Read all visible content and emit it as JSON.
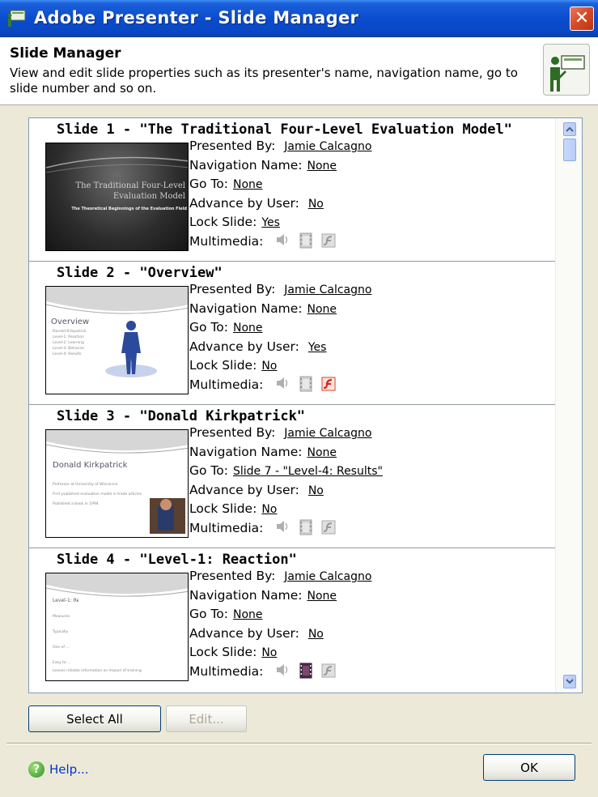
{
  "window": {
    "title": "Adobe Presenter - Slide Manager",
    "close_glyph": "✕"
  },
  "header": {
    "title": "Slide Manager",
    "description": "View and edit slide properties such as its presenter's name, navigation name, go to slide number and so on."
  },
  "labels": {
    "presented_by": "Presented By:",
    "navigation_name": "Navigation Name:",
    "go_to": "Go To:",
    "advance_by_user": "Advance by User:",
    "lock_slide": "Lock Slide:",
    "multimedia": "Multimedia:"
  },
  "slides": [
    {
      "heading": "Slide 1 - \"The Traditional Four-Level Evaluation Model\"",
      "thumb_title": "The Traditional Four-Level Evaluation Model",
      "thumb_subtitle": "The Theoretical Beginnings of the Evaluation Field",
      "presented_by": "Jamie Calcagno",
      "navigation_name": "None",
      "go_to": "None",
      "advance_by_user": "No",
      "lock_slide": "Yes",
      "multimedia": {
        "audio": false,
        "video": false,
        "flash": false
      }
    },
    {
      "heading": "Slide 2 - \"Overview\"",
      "thumb_title": "Overview",
      "thumb_bullets": [
        "Donald Kirkpatrick",
        "Level-1: Reaction",
        "Level-2: Learning",
        "Level-3: Behavior",
        "Level-4: Results"
      ],
      "presented_by": "Jamie Calcagno",
      "navigation_name": "None",
      "go_to": "None",
      "advance_by_user": "Yes",
      "lock_slide": "No",
      "multimedia": {
        "audio": false,
        "video": false,
        "flash": true
      }
    },
    {
      "heading": "Slide 3 - \"Donald Kirkpatrick\"",
      "thumb_title": "Donald Kirkpatrick",
      "thumb_bullets": [
        "Professor at University of Wisconsin",
        "First published evaluation model in trade articles",
        "Published a book in 1994"
      ],
      "presented_by": "Jamie Calcagno",
      "navigation_name": "None",
      "go_to": "Slide 7 - \"Level-4: Results\"",
      "advance_by_user": "No",
      "lock_slide": "No",
      "multimedia": {
        "audio": false,
        "video": false,
        "flash": false
      }
    },
    {
      "heading": "Slide 4 - \"Level-1: Reaction\"",
      "thumb_title": "Level-1: Reaction",
      "thumb_bullets": [
        "Measures",
        "Typically",
        "One of ...",
        "Easy to ...",
        "Leaves reliable information on impact of training"
      ],
      "presented_by": "Jamie Calcagno",
      "navigation_name": "None",
      "go_to": "None",
      "advance_by_user": "No",
      "lock_slide": "No",
      "multimedia": {
        "audio": false,
        "video": true,
        "flash": false
      }
    }
  ],
  "buttons": {
    "select_all": "Select All",
    "edit": "Edit...",
    "ok": "OK",
    "help": "Help..."
  }
}
